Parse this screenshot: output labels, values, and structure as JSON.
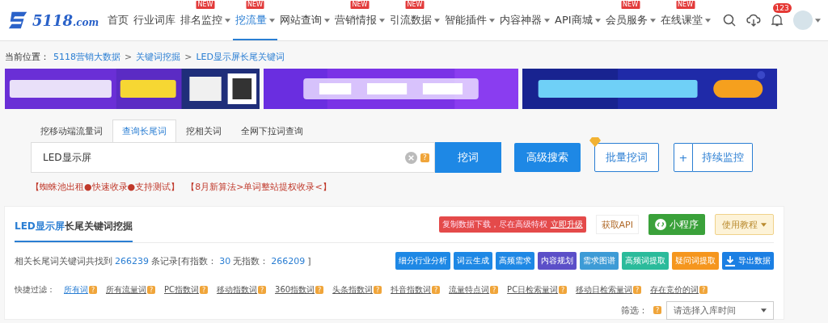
{
  "logo": {
    "text": "5118",
    "suffix": ".com"
  },
  "nav": [
    {
      "label": "首页",
      "dropdown": false,
      "selected": false
    },
    {
      "label": "行业词库",
      "dropdown": false,
      "selected": false
    },
    {
      "label": "排名监控",
      "dropdown": true,
      "badge": "NEW",
      "selected": false
    },
    {
      "label": "挖流量",
      "dropdown": true,
      "badge": "NEW",
      "selected": true
    },
    {
      "label": "网站查询",
      "dropdown": true,
      "selected": false
    },
    {
      "label": "营销情报",
      "dropdown": true,
      "badge": "NEW",
      "selected": false
    },
    {
      "label": "引流数据",
      "dropdown": true,
      "badge": "NEW",
      "selected": false
    },
    {
      "label": "智能插件",
      "dropdown": true,
      "selected": false
    },
    {
      "label": "内容神器",
      "dropdown": true,
      "selected": false
    },
    {
      "label": "API商城",
      "dropdown": true,
      "selected": false
    },
    {
      "label": "会员服务",
      "dropdown": true,
      "badge": "NEW",
      "selected": false
    },
    {
      "label": "在线课堂",
      "dropdown": true,
      "badge": "NEW",
      "selected": false
    }
  ],
  "notification_count": "123",
  "breadcrumb": {
    "label": "当前位置：",
    "items": [
      "5118营销大数据",
      "关键词挖掘",
      "LED显示屏长尾关键词"
    ],
    "separator": ">"
  },
  "banners": [
    {
      "kind": "picture"
    },
    {
      "kind": "picture"
    },
    {
      "kind": "picture"
    }
  ],
  "tabs": [
    {
      "label": "挖移动端流量词",
      "selected": false
    },
    {
      "label": "查询长尾词",
      "selected": true
    },
    {
      "label": "挖相关词",
      "selected": false
    },
    {
      "label": "全网下拉词查询",
      "selected": false
    }
  ],
  "search": {
    "value": "LED显示屏",
    "help": "?"
  },
  "buttons": {
    "search": "挖词",
    "advanced": "高级搜索",
    "batch": "批量挖词",
    "monitor_plus": "+",
    "monitor": "持续监控"
  },
  "promos": [
    "【蜘蛛池出租●快速收录●支持测试】",
    "【8月新算法>单词整站提权收录<】"
  ],
  "card": {
    "title_keyword": "LED显示屏",
    "title_rest": "长尾关键词挖掘",
    "upgrade": {
      "text": "复制数据下载，尽在高级特权",
      "link": "立即升级"
    },
    "api": "获取API",
    "mini_program": "小程序",
    "tutorial": "使用教程",
    "stats": [
      {
        "kind": "text",
        "text": "相关长尾词关键词共找到"
      },
      {
        "kind": "number",
        "text": "266239"
      },
      {
        "kind": "text",
        "text": "条记录[有指数："
      },
      {
        "kind": "number",
        "text": "30"
      },
      {
        "kind": "text",
        "text": "无指数："
      },
      {
        "kind": "number",
        "text": "266209"
      },
      {
        "kind": "text",
        "text": "]"
      }
    ],
    "actions": [
      {
        "label": "细分行业分析",
        "color": "#1e88e5"
      },
      {
        "label": "词云生成",
        "color": "#1e88e5"
      },
      {
        "label": "高频需求",
        "color": "#1e88e5"
      },
      {
        "label": "内容规划",
        "color": "#5b4fc8"
      },
      {
        "label": "需求图谱",
        "color": "#3d9bd6"
      },
      {
        "label": "高频词提取",
        "color": "#2bbb9b"
      },
      {
        "label": "疑问词提取",
        "color": "#f5961e"
      },
      {
        "label": "导出数据",
        "color": "#1b7fe3",
        "kind": "download"
      }
    ],
    "filter_label": "快捷过滤：",
    "filters": [
      {
        "label": "所有词",
        "help": "?",
        "selected": true
      },
      {
        "label": "所有流量词",
        "help": "?",
        "selected": false
      },
      {
        "label": "PC指数词",
        "help": "?",
        "selected": false
      },
      {
        "label": "移动指数词",
        "help": "?",
        "selected": false
      },
      {
        "label": "360指数词",
        "help": "?",
        "selected": false
      },
      {
        "label": "头条指数词",
        "help": "?",
        "selected": false
      },
      {
        "label": "抖音指数词",
        "help": "?",
        "selected": false
      },
      {
        "label": "流量特点词",
        "help": "?",
        "selected": false
      },
      {
        "label": "PC日检索量词",
        "help": "?",
        "selected": false
      },
      {
        "label": "移动日检索量词",
        "help": "?",
        "selected": false
      },
      {
        "label": "存在竞价的词",
        "help": "?",
        "selected": false
      }
    ],
    "sift": {
      "label": "筛选：",
      "help": "?",
      "placeholder": "请选择入库时间"
    }
  }
}
